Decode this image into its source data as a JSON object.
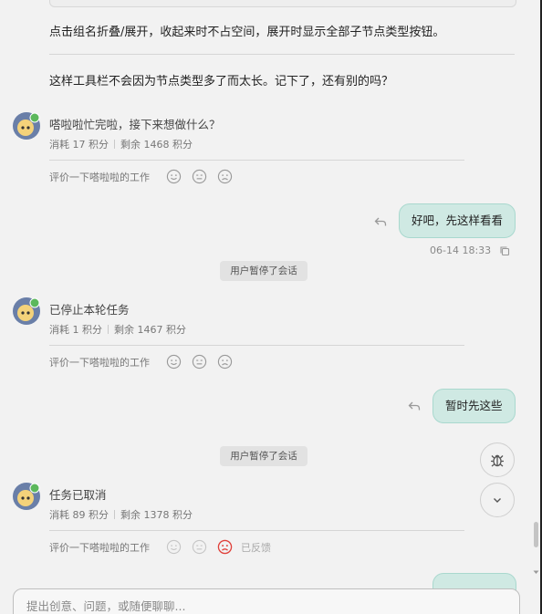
{
  "messages": {
    "intro_line_1": "点击组名折叠/展开，收起来时不占空间，展开时显示全部子节点类型按钮。",
    "intro_line_2": "这样工具栏不会因为节点类型多了而太长。记下了，还有别的吗？",
    "block1": {
      "text": "嗒啦啦忙完啦，接下来想做什么？",
      "cost": "消耗 17 积分",
      "remain": "剩余 1468 积分"
    },
    "block2": {
      "text": "已停止本轮任务",
      "cost": "消耗 1 积分",
      "remain": "剩余 1467 积分"
    },
    "block3": {
      "text": "任务已取消",
      "cost": "消耗 89 积分",
      "remain": "剩余 1378 积分"
    },
    "rate_prompt": "评价一下嗒啦啦的工作",
    "feedback_done": "已反馈"
  },
  "user_messages": [
    {
      "text": "好吧，先这样看看",
      "time": "06-14 18:33"
    },
    {
      "text": "暂时先这些"
    }
  ],
  "system_notice": "用户暂停了会话",
  "composer": {
    "placeholder": "提出创意、问题，或随便聊聊..."
  },
  "icons": {
    "avatar": "assistant-avatar",
    "reply": "reply-icon",
    "copy": "copy-icon",
    "bug": "bug-icon",
    "scroll_down": "chevron-down-icon",
    "faces": [
      "smile-face-icon",
      "neutral-face-icon",
      "sad-face-icon"
    ]
  },
  "colors": {
    "user_bubble": "#cfe9e3",
    "user_bubble_border": "#a9d8ce",
    "selected_rating": "#e0403a",
    "background": "#f2f2f2"
  }
}
